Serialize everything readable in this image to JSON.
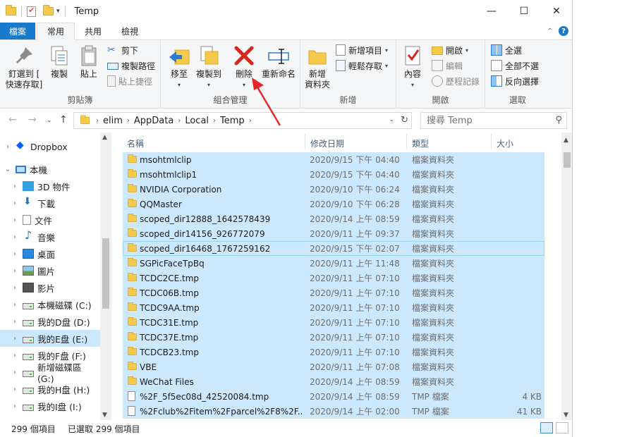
{
  "window": {
    "title": "Temp",
    "controls": {
      "minimize": "—",
      "maximize": "☐",
      "close": "✕"
    }
  },
  "ribbon_tabs": [
    "檔案",
    "常用",
    "共用",
    "檢視"
  ],
  "ribbon": {
    "clipboard": {
      "label": "剪貼簿",
      "pin": "釘選到 [\n快速存取]",
      "copy": "複製",
      "paste": "貼上",
      "cut": "剪下",
      "copy_path": "複製路徑",
      "paste_shortcut": "貼上捷徑"
    },
    "organize": {
      "label": "組合管理",
      "move_to": "移至",
      "copy_to": "複製到",
      "delete": "刪除",
      "rename": "重新命名"
    },
    "new": {
      "label": "新增",
      "new_folder": "新增\n資料夾",
      "new_item": "新增項目",
      "easy_access": "輕鬆存取"
    },
    "open": {
      "label": "開啟",
      "properties": "內容",
      "open": "開啟",
      "edit": "編輯",
      "history": "歷程記錄"
    },
    "select": {
      "label": "選取",
      "select_all": "全選",
      "select_none": "全部不選",
      "invert": "反向選擇"
    }
  },
  "address": {
    "crumbs": [
      "elim",
      "AppData",
      "Local",
      "Temp"
    ],
    "search_placeholder": "搜尋 Temp"
  },
  "nav_pane": [
    {
      "label": "Dropbox",
      "icon": "dropbox-icon",
      "expander": "›"
    },
    {
      "label": "本機",
      "icon": "pc-icon",
      "expander": "⌄"
    },
    {
      "label": "3D 物件",
      "icon": "3d-objects-icon",
      "expander": "›"
    },
    {
      "label": "下載",
      "icon": "download-icon",
      "expander": "›"
    },
    {
      "label": "文件",
      "icon": "document-icon",
      "expander": "›"
    },
    {
      "label": "音樂",
      "icon": "music-icon",
      "expander": "›"
    },
    {
      "label": "桌面",
      "icon": "desktop-icon",
      "expander": "›"
    },
    {
      "label": "圖片",
      "icon": "pictures-icon",
      "expander": "›"
    },
    {
      "label": "影片",
      "icon": "videos-icon",
      "expander": "›"
    },
    {
      "label": "本機磁碟 (C:)",
      "icon": "drive-icon",
      "expander": "›"
    },
    {
      "label": "我的D盘 (D:)",
      "icon": "drive-icon",
      "expander": "›"
    },
    {
      "label": "我的E盘 (E:)",
      "icon": "drive-icon",
      "expander": "›"
    },
    {
      "label": "我的F盘 (F:)",
      "icon": "drive-icon",
      "expander": "›"
    },
    {
      "label": "新增磁碟區 (G:)",
      "icon": "drive-icon",
      "expander": "›"
    },
    {
      "label": "我的H盘 (H:)",
      "icon": "drive-icon",
      "expander": "›"
    },
    {
      "label": "我的I盘 (I:)",
      "icon": "drive-icon",
      "expander": "›"
    }
  ],
  "columns": {
    "name": "名稱",
    "date": "修改日期",
    "type": "類型",
    "size": "大小"
  },
  "files": [
    {
      "name": "msohtmlclip",
      "date": "2020/9/15 下午 04:40",
      "type": "檔案資料夾",
      "size": "",
      "kind": "folder"
    },
    {
      "name": "msohtmlclip1",
      "date": "2020/9/15 下午 04:40",
      "type": "檔案資料夾",
      "size": "",
      "kind": "folder"
    },
    {
      "name": "NVIDIA Corporation",
      "date": "2020/9/10 下午 06:24",
      "type": "檔案資料夾",
      "size": "",
      "kind": "folder"
    },
    {
      "name": "QQMaster",
      "date": "2020/9/10 下午 06:28",
      "type": "檔案資料夾",
      "size": "",
      "kind": "folder"
    },
    {
      "name": "scoped_dir12888_1642578439",
      "date": "2020/9/14 上午 08:59",
      "type": "檔案資料夾",
      "size": "",
      "kind": "folder"
    },
    {
      "name": "scoped_dir14156_926772079",
      "date": "2020/9/11 上午 09:37",
      "type": "檔案資料夾",
      "size": "",
      "kind": "folder"
    },
    {
      "name": "scoped_dir16468_1767259162",
      "date": "2020/9/15 下午 02:07",
      "type": "檔案資料夾",
      "size": "",
      "kind": "folder"
    },
    {
      "name": "SGPicFaceTpBq",
      "date": "2020/9/11 上午 11:48",
      "type": "檔案資料夾",
      "size": "",
      "kind": "folder"
    },
    {
      "name": "TCDC2CE.tmp",
      "date": "2020/9/11 上午 07:10",
      "type": "檔案資料夾",
      "size": "",
      "kind": "folder"
    },
    {
      "name": "TCDC06B.tmp",
      "date": "2020/9/11 上午 07:10",
      "type": "檔案資料夾",
      "size": "",
      "kind": "folder"
    },
    {
      "name": "TCDC9AA.tmp",
      "date": "2020/9/11 上午 07:10",
      "type": "檔案資料夾",
      "size": "",
      "kind": "folder"
    },
    {
      "name": "TCDC31E.tmp",
      "date": "2020/9/11 上午 07:10",
      "type": "檔案資料夾",
      "size": "",
      "kind": "folder"
    },
    {
      "name": "TCDC37E.tmp",
      "date": "2020/9/11 上午 07:10",
      "type": "檔案資料夾",
      "size": "",
      "kind": "folder"
    },
    {
      "name": "TCDCB23.tmp",
      "date": "2020/9/11 上午 07:10",
      "type": "檔案資料夾",
      "size": "",
      "kind": "folder"
    },
    {
      "name": "VBE",
      "date": "2020/9/11 上午 07:08",
      "type": "檔案資料夾",
      "size": "",
      "kind": "folder"
    },
    {
      "name": "WeChat Files",
      "date": "2020/9/14 上午 08:59",
      "type": "檔案資料夾",
      "size": "",
      "kind": "folder"
    },
    {
      "name": "%2F_5f5ec08d_42520084.tmp",
      "date": "2020/9/14 上午 08:59",
      "type": "TMP 檔案",
      "size": "4 KB",
      "kind": "file"
    },
    {
      "name": "%2Fclub%2Fitem%2Fparcel%2F8%2F...",
      "date": "2020/9/14 上午 02:00",
      "type": "TMP 檔案",
      "size": "41 KB",
      "kind": "file"
    }
  ],
  "status": {
    "count": "299 個項目",
    "selected": "已選取 299 個項目"
  },
  "colors": {
    "accent": "#1979ca",
    "selection": "#cce8ff",
    "annotation": "#e8262a"
  }
}
